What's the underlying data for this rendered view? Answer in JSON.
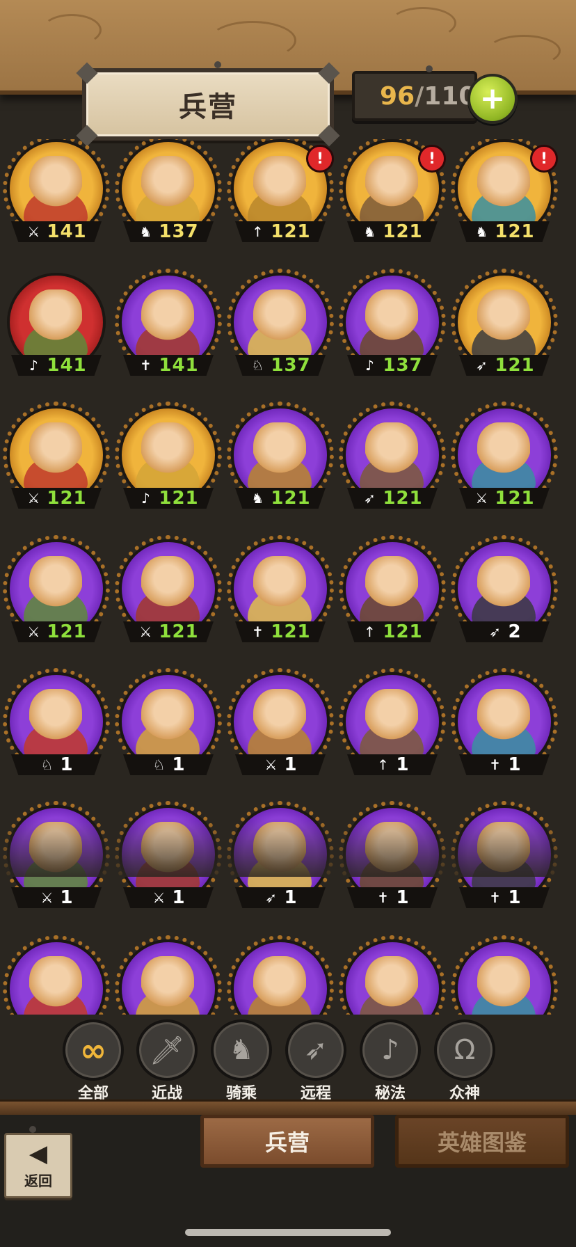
{
  "header": {
    "title": "兵营",
    "troop_count": "96",
    "troop_separator": "/",
    "troop_max": "110",
    "add_label": "+"
  },
  "heroes": [
    {
      "frame": "gold",
      "class_icon": "sword-icon",
      "class_glyph": "⚔",
      "level": "141",
      "level_color": "gold",
      "alert": false
    },
    {
      "frame": "gold",
      "class_icon": "horse-icon",
      "class_glyph": "♞",
      "level": "137",
      "level_color": "gold",
      "alert": false
    },
    {
      "frame": "gold",
      "class_icon": "spear-icon",
      "class_glyph": "↑",
      "level": "121",
      "level_color": "gold",
      "alert": true
    },
    {
      "frame": "gold",
      "class_icon": "horse-icon",
      "class_glyph": "♞",
      "level": "121",
      "level_color": "gold",
      "alert": true
    },
    {
      "frame": "gold",
      "class_icon": "horse-icon",
      "class_glyph": "♞",
      "level": "121",
      "level_color": "gold",
      "alert": true
    },
    {
      "frame": "red",
      "class_icon": "staff-icon",
      "class_glyph": "♪",
      "level": "141",
      "level_color": "green",
      "alert": false
    },
    {
      "frame": "purple",
      "class_icon": "holy-icon",
      "class_glyph": "✝",
      "level": "141",
      "level_color": "green",
      "alert": false
    },
    {
      "frame": "purple",
      "class_icon": "mount-icon",
      "class_glyph": "♘",
      "level": "137",
      "level_color": "green",
      "alert": false
    },
    {
      "frame": "purple",
      "class_icon": "staff-icon",
      "class_glyph": "♪",
      "level": "137",
      "level_color": "green",
      "alert": false
    },
    {
      "frame": "gold",
      "class_icon": "bow-icon",
      "class_glyph": "➶",
      "level": "121",
      "level_color": "green",
      "alert": false
    },
    {
      "frame": "gold",
      "class_icon": "sword-icon",
      "class_glyph": "⚔",
      "level": "121",
      "level_color": "green",
      "alert": false
    },
    {
      "frame": "gold",
      "class_icon": "staff-icon",
      "class_glyph": "♪",
      "level": "121",
      "level_color": "green",
      "alert": false
    },
    {
      "frame": "purple",
      "class_icon": "horse-icon",
      "class_glyph": "♞",
      "level": "121",
      "level_color": "green",
      "alert": false
    },
    {
      "frame": "purple",
      "class_icon": "bow-icon",
      "class_glyph": "➶",
      "level": "121",
      "level_color": "green",
      "alert": false
    },
    {
      "frame": "purple",
      "class_icon": "sword-icon",
      "class_glyph": "⚔",
      "level": "121",
      "level_color": "green",
      "alert": false
    },
    {
      "frame": "purple",
      "class_icon": "sword-icon",
      "class_glyph": "⚔",
      "level": "121",
      "level_color": "green",
      "alert": false
    },
    {
      "frame": "purple",
      "class_icon": "sword-icon",
      "class_glyph": "⚔",
      "level": "121",
      "level_color": "green",
      "alert": false
    },
    {
      "frame": "purple",
      "class_icon": "holy-icon",
      "class_glyph": "✝",
      "level": "121",
      "level_color": "green",
      "alert": false
    },
    {
      "frame": "purple",
      "class_icon": "spear-icon",
      "class_glyph": "↑",
      "level": "121",
      "level_color": "green",
      "alert": false
    },
    {
      "frame": "purple",
      "class_icon": "bow-icon",
      "class_glyph": "➶",
      "level": "2",
      "level_color": "white",
      "alert": false
    },
    {
      "frame": "purple",
      "class_icon": "mount-icon",
      "class_glyph": "♘",
      "level": "1",
      "level_color": "white",
      "alert": false
    },
    {
      "frame": "purple",
      "class_icon": "mount-icon",
      "class_glyph": "♘",
      "level": "1",
      "level_color": "white",
      "alert": false
    },
    {
      "frame": "purple",
      "class_icon": "sword-icon",
      "class_glyph": "⚔",
      "level": "1",
      "level_color": "white",
      "alert": false
    },
    {
      "frame": "purple",
      "class_icon": "spear-icon",
      "class_glyph": "↑",
      "level": "1",
      "level_color": "white",
      "alert": false
    },
    {
      "frame": "purple",
      "class_icon": "holy-icon",
      "class_glyph": "✝",
      "level": "1",
      "level_color": "white",
      "alert": false
    },
    {
      "frame": "purple",
      "class_icon": "sword-icon",
      "class_glyph": "⚔",
      "level": "1",
      "level_color": "white",
      "alert": false
    },
    {
      "frame": "purple",
      "class_icon": "sword-icon",
      "class_glyph": "⚔",
      "level": "1",
      "level_color": "white",
      "alert": false
    },
    {
      "frame": "purple",
      "class_icon": "bow-icon",
      "class_glyph": "➶",
      "level": "1",
      "level_color": "white",
      "alert": false
    },
    {
      "frame": "purple",
      "class_icon": "holy-icon",
      "class_glyph": "✝",
      "level": "1",
      "level_color": "white",
      "alert": false
    },
    {
      "frame": "purple",
      "class_icon": "holy-icon",
      "class_glyph": "✝",
      "level": "1",
      "level_color": "white",
      "alert": false
    },
    {
      "frame": "purple",
      "class_icon": "",
      "class_glyph": "",
      "level": "",
      "level_color": "white",
      "alert": false
    },
    {
      "frame": "purple",
      "class_icon": "",
      "class_glyph": "",
      "level": "",
      "level_color": "white",
      "alert": false
    },
    {
      "frame": "purple",
      "class_icon": "",
      "class_glyph": "",
      "level": "",
      "level_color": "white",
      "alert": false
    },
    {
      "frame": "purple",
      "class_icon": "",
      "class_glyph": "",
      "level": "",
      "level_color": "white",
      "alert": false
    },
    {
      "frame": "purple",
      "class_icon": "",
      "class_glyph": "",
      "level": "",
      "level_color": "white",
      "alert": false
    }
  ],
  "filters": [
    {
      "label": "全部",
      "icon": "infinity-icon",
      "glyph": "∞",
      "active": true
    },
    {
      "label": "近战",
      "icon": "sword-icon",
      "glyph": "🗡",
      "active": false
    },
    {
      "label": "骑乘",
      "icon": "horse-head-icon",
      "glyph": "♞",
      "active": false
    },
    {
      "label": "远程",
      "icon": "bow-icon",
      "glyph": "➶",
      "active": false
    },
    {
      "label": "秘法",
      "icon": "magic-staff-icon",
      "glyph": "♪",
      "active": false
    },
    {
      "label": "众神",
      "icon": "omega-icon",
      "glyph": "Ω",
      "active": false
    }
  ],
  "tabs": {
    "barracks": "兵营",
    "hero_catalog": "英雄图鉴"
  },
  "back_button": {
    "label": "返回",
    "icon": "back-arrow-icon"
  },
  "colors": {
    "gold_frame": "#f0b43c",
    "purple_frame": "#8d3fd8",
    "red_frame": "#cf3030",
    "level_gold": "#f4e06a",
    "level_green": "#8fe03c",
    "troop_count": "#e9b64c",
    "add_button": "#a6c92d"
  }
}
